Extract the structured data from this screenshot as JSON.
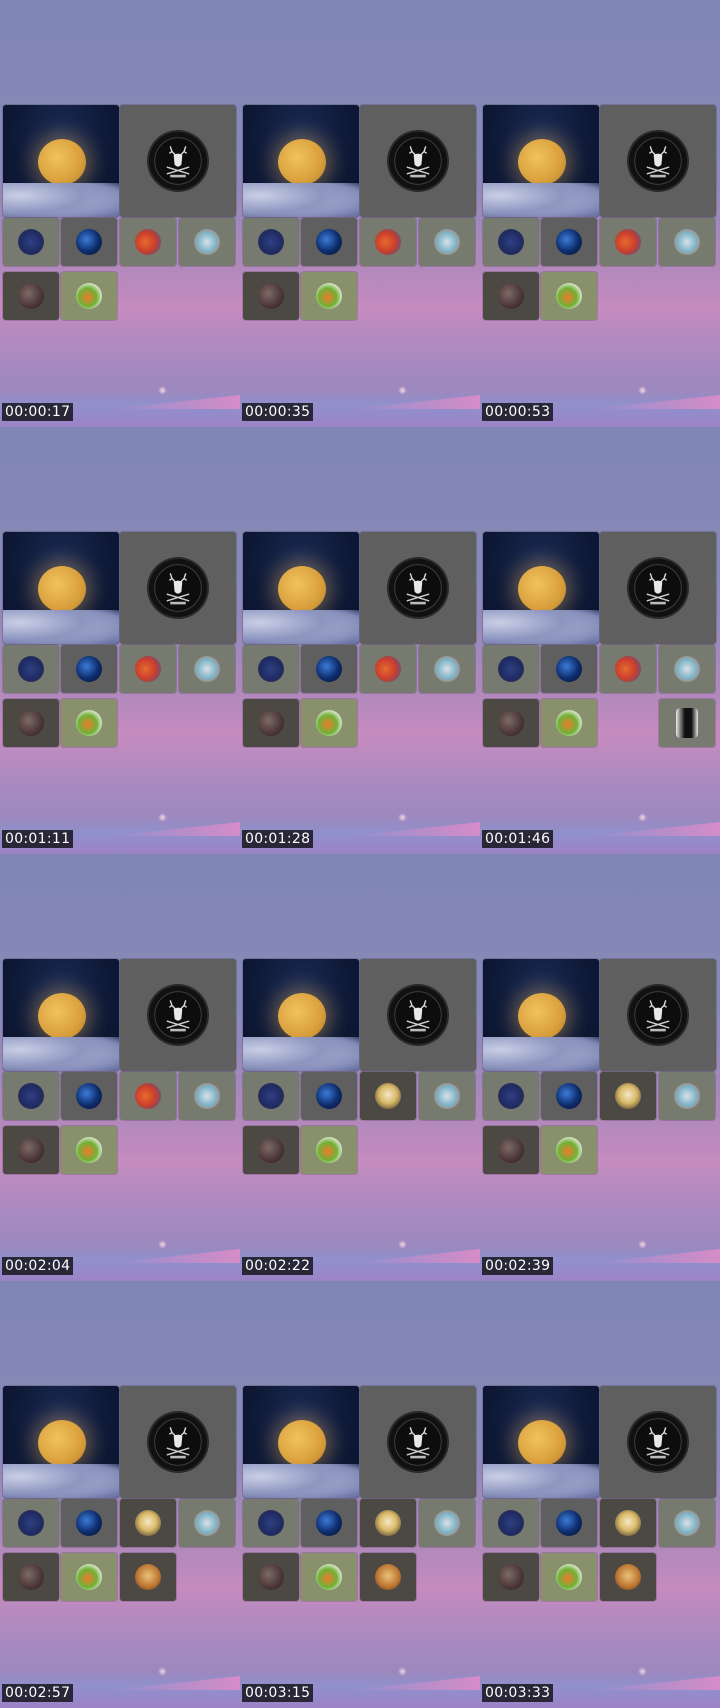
{
  "frames": [
    {
      "timestamp": "00:00:17",
      "tiles": [
        "star",
        "planet",
        "fire",
        "badge",
        "rock",
        "green"
      ]
    },
    {
      "timestamp": "00:00:35",
      "tiles": [
        "star",
        "planet",
        "fire",
        "badge",
        "rock",
        "green"
      ]
    },
    {
      "timestamp": "00:00:53",
      "tiles": [
        "star",
        "planet",
        "fire",
        "badge",
        "rock",
        "green"
      ]
    },
    {
      "timestamp": "00:01:11",
      "tiles": [
        "star",
        "planet",
        "fire",
        "badge",
        "rock",
        "green"
      ]
    },
    {
      "timestamp": "00:01:28",
      "tiles": [
        "star",
        "planet",
        "fire",
        "badge",
        "rock",
        "green"
      ]
    },
    {
      "timestamp": "00:01:46",
      "tiles": [
        "star",
        "planet",
        "fire",
        "badge",
        "rock",
        "green",
        "photo"
      ]
    },
    {
      "timestamp": "00:02:04",
      "tiles": [
        "star",
        "planet",
        "fire",
        "badge",
        "rock",
        "green"
      ]
    },
    {
      "timestamp": "00:02:22",
      "tiles": [
        "star",
        "planet",
        "silhouette",
        "badge",
        "rock",
        "green"
      ]
    },
    {
      "timestamp": "00:02:39",
      "tiles": [
        "star",
        "planet",
        "silhouette",
        "badge",
        "rock",
        "green"
      ]
    },
    {
      "timestamp": "00:02:57",
      "tiles": [
        "star",
        "planet",
        "silhouette",
        "badge",
        "rock",
        "green",
        "lion"
      ]
    },
    {
      "timestamp": "00:03:15",
      "tiles": [
        "star",
        "planet",
        "silhouette",
        "badge",
        "rock",
        "green",
        "lion"
      ]
    },
    {
      "timestamp": "00:03:33",
      "tiles": [
        "star",
        "planet",
        "silhouette",
        "badge",
        "rock",
        "green",
        "lion"
      ]
    }
  ],
  "icons": {
    "moon_tile": "moon-cloud-icon",
    "stag_tile": "stag-emblem-icon"
  },
  "colors": {
    "sky_top": "#7f86b4",
    "sky_pink": "#c58bbf",
    "tile_gray": "#5f5f5f"
  }
}
